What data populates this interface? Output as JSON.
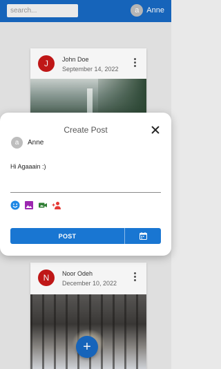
{
  "header": {
    "search_placeholder": "search...",
    "user_initial": "a",
    "user_name": "Anne"
  },
  "posts": [
    {
      "avatar_initial": "J",
      "author": "John Doe",
      "date": "September 14, 2022",
      "image": "misty-forest-waterfall"
    },
    {
      "avatar_initial": "N",
      "author": "Noor Odeh",
      "date": "December 10, 2022",
      "image": "snowy-forest-path"
    }
  ],
  "modal": {
    "title": "Create Post",
    "user_initial": "a",
    "user_name": "Anne",
    "text": "Hi Agaaain :)",
    "tools": [
      "emoji-icon",
      "image-icon",
      "video-icon",
      "tag-user-icon"
    ],
    "post_label": "POST",
    "schedule_icon": "calendar-icon"
  },
  "colors": {
    "primary": "#1769c2",
    "button": "#1976d2",
    "avatar_red": "#c71818"
  }
}
